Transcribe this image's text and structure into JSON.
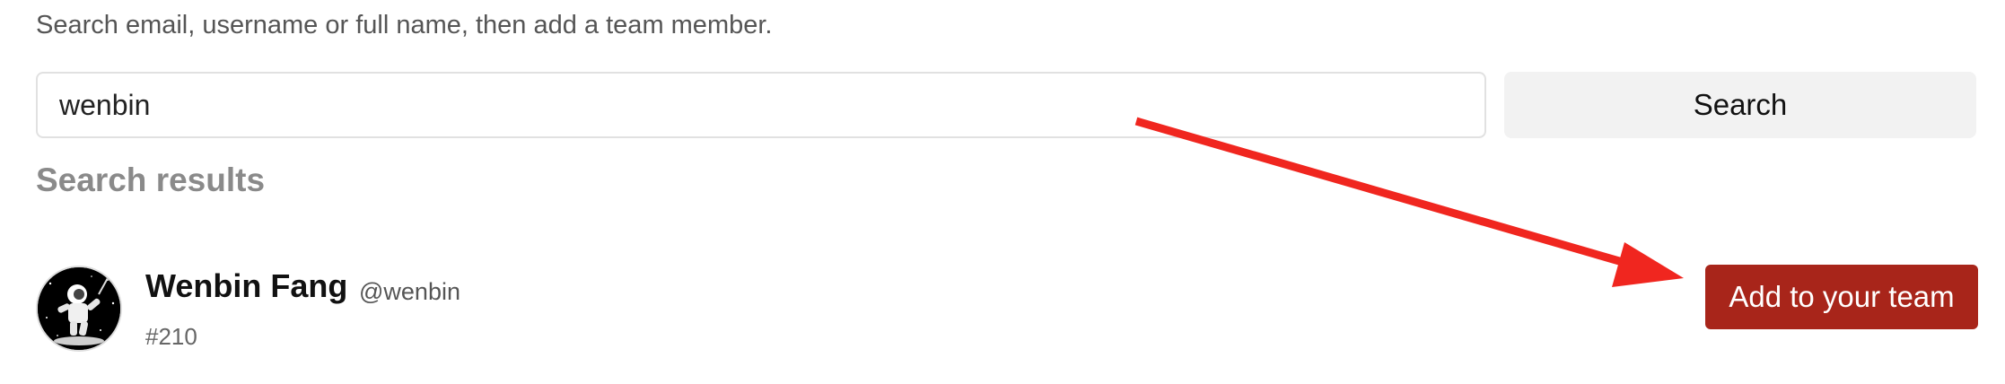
{
  "instructions": "Search email, username or full name, then add a team member.",
  "search": {
    "value": "wenbin",
    "button_label": "Search"
  },
  "results": {
    "heading": "Search results",
    "items": [
      {
        "name": "Wenbin Fang",
        "handle": "@wenbin",
        "id": "#210",
        "add_label": "Add to your team"
      }
    ]
  },
  "colors": {
    "add_button": "#a8251a",
    "annotation_arrow": "#f0261f"
  },
  "icons": {
    "avatar": "astronaut-avatar",
    "annotation": "red-arrow-annotation"
  }
}
